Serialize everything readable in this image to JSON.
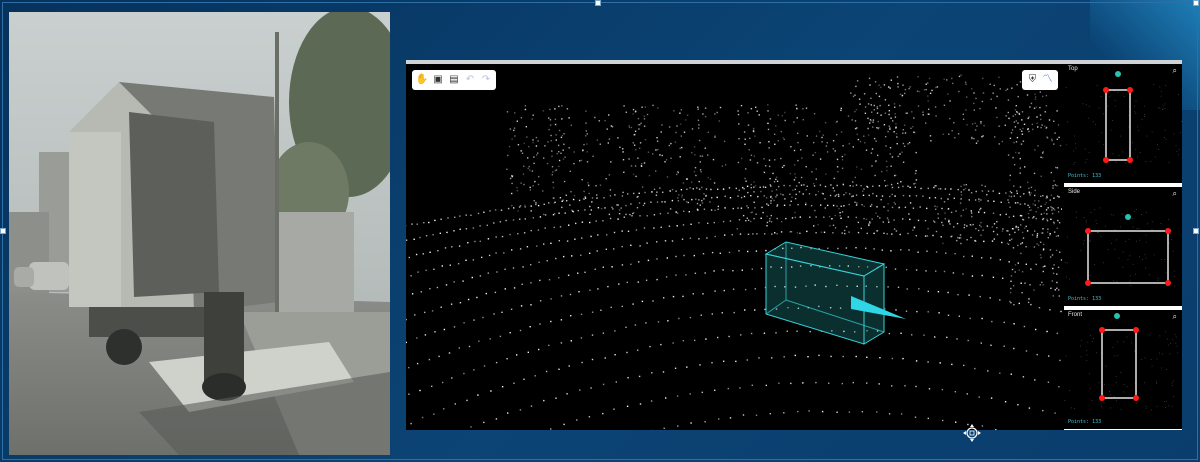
{
  "camera": {
    "icon": "camera-image-view"
  },
  "toolbar": {
    "tools": [
      {
        "icon": "hand-icon",
        "state": "active"
      },
      {
        "icon": "box-icon",
        "state": "normal"
      },
      {
        "icon": "comment-icon",
        "state": "normal"
      },
      {
        "icon": "undo-icon",
        "state": "disabled"
      },
      {
        "icon": "redo-icon",
        "state": "disabled"
      }
    ],
    "right_tools": [
      {
        "icon": "shield-icon"
      },
      {
        "icon": "line-chart-icon"
      }
    ]
  },
  "annotation": {
    "box_color": "#34d2d6",
    "arrow_color": "#2fd6e6"
  },
  "side_views": [
    {
      "label": "Top",
      "points": "Points: 133"
    },
    {
      "label": "Side",
      "points": "Points: 133"
    },
    {
      "label": "Front",
      "points": "Points: 133"
    }
  ],
  "colors": {
    "slide_bg": "#0b4475",
    "handle_point": "#ff1a1a",
    "rotate_handle": "#27c2b0"
  }
}
